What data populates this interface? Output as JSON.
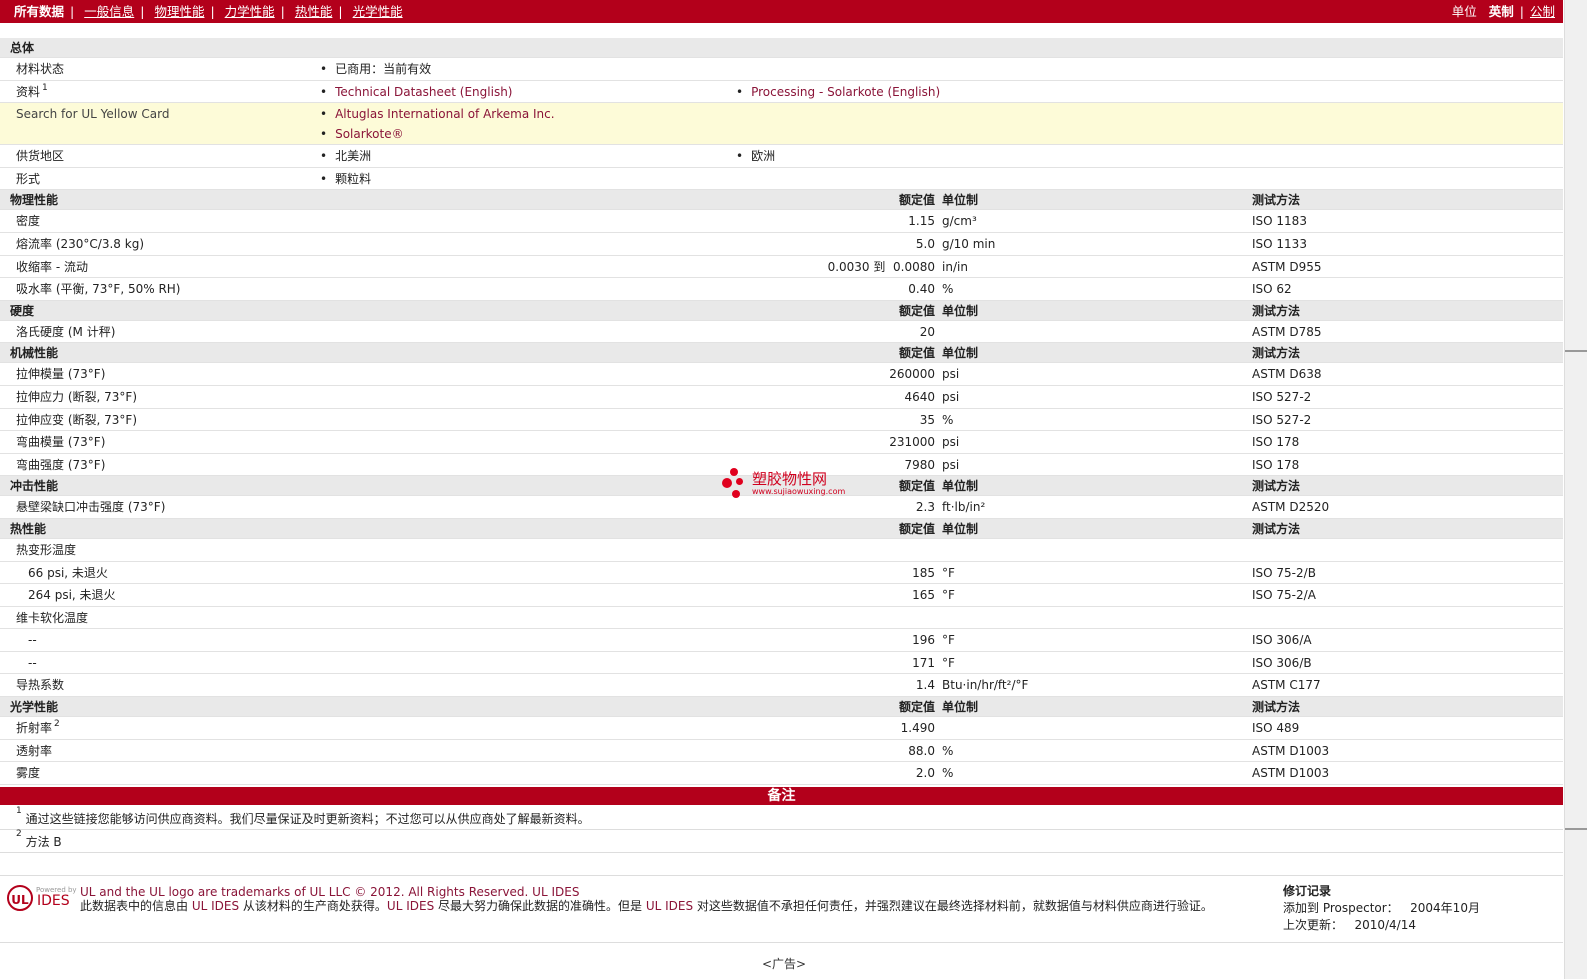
{
  "nav": {
    "items": [
      "所有数据",
      "一般信息",
      "物理性能",
      "力学性能",
      "热性能",
      "光学性能"
    ],
    "unit_label": "单位",
    "unit_imperial": "英制",
    "unit_metric": "公制"
  },
  "general": {
    "title": "总体",
    "material_status_label": "材料状态",
    "material_status_value": "已商用：当前有效",
    "docs_label": "资料",
    "docs_sup": "1",
    "doc1": "Technical Datasheet (English)",
    "doc2": "Processing - Solarkote (English)",
    "ul_label": "Search for UL Yellow Card",
    "ul1": "Altuglas International of Arkema Inc.",
    "ul2": "Solarkote®",
    "region_label": "供货地区",
    "region1": "北美洲",
    "region2": "欧洲",
    "form_label": "形式",
    "form_value": "颗粒料"
  },
  "col_headers": {
    "value": "额定值",
    "unit": "单位制",
    "test": "测试方法"
  },
  "physical": {
    "title": "物理性能",
    "rows": [
      {
        "label": "密度",
        "cond": "",
        "value": "1.15",
        "unit": "g/cm³",
        "test": "ISO 1183"
      },
      {
        "label": "熔流率",
        "cond": "(230°C/3.8 kg)",
        "value": "5.0",
        "unit": "g/10 min",
        "test": "ISO 1133"
      },
      {
        "label": "收缩率",
        "cond": "- 流动",
        "value": "0.0030 到  0.0080",
        "unit": "in/in",
        "test": "ASTM D955"
      },
      {
        "label": "吸水率",
        "cond": "(平衡, 73°F, 50% RH)",
        "value": "0.40",
        "unit": "%",
        "test": "ISO 62"
      }
    ]
  },
  "hardness": {
    "title": "硬度",
    "rows": [
      {
        "label": "洛氏硬度",
        "cond": "(M 计秤)",
        "value": "20",
        "unit": "",
        "test": "ASTM D785"
      }
    ]
  },
  "mechanical": {
    "title": "机械性能",
    "rows": [
      {
        "label": "拉伸模量",
        "cond": "(73°F)",
        "value": "260000",
        "unit": "psi",
        "test": "ASTM D638"
      },
      {
        "label": "拉伸应力",
        "cond": "(断裂, 73°F)",
        "value": "4640",
        "unit": "psi",
        "test": "ISO 527-2"
      },
      {
        "label": "拉伸应变",
        "cond": "(断裂, 73°F)",
        "value": "35",
        "unit": "%",
        "test": "ISO 527-2"
      },
      {
        "label": "弯曲模量",
        "cond": "(73°F)",
        "value": "231000",
        "unit": "psi",
        "test": "ISO 178"
      },
      {
        "label": "弯曲强度",
        "cond": "(73°F)",
        "value": "7980",
        "unit": "psi",
        "test": "ISO 178"
      }
    ]
  },
  "impact": {
    "title": "冲击性能",
    "rows": [
      {
        "label": "悬壁梁缺口冲击强度",
        "cond": "(73°F)",
        "value": "2.3",
        "unit": "ft·lb/in²",
        "test": "ASTM D2520"
      }
    ]
  },
  "thermal": {
    "title": "热性能",
    "hdt_label": "热变形温度",
    "hdt_rows": [
      {
        "label": "66 psi, 未退火",
        "value": "185",
        "unit": "°F",
        "test": "ISO 75-2/B"
      },
      {
        "label": "264 psi, 未退火",
        "value": "165",
        "unit": "°F",
        "test": "ISO 75-2/A"
      }
    ],
    "vicat_label": "维卡软化温度",
    "vicat_rows": [
      {
        "label": "--",
        "value": "196",
        "unit": "°F",
        "test": "ISO 306/A"
      },
      {
        "label": "--",
        "value": "171",
        "unit": "°F",
        "test": "ISO 306/B"
      }
    ],
    "conductivity": {
      "label": "导热系数",
      "value": "1.4",
      "unit": "Btu·in/hr/ft²/°F",
      "test": "ASTM C177"
    }
  },
  "optical": {
    "title": "光学性能",
    "rows": [
      {
        "label": "折射率",
        "sup": "2",
        "value": "1.490",
        "unit": "",
        "test": "ISO 489"
      },
      {
        "label": "透射率",
        "sup": "",
        "value": "88.0",
        "unit": "%",
        "test": "ASTM D1003"
      },
      {
        "label": "雾度",
        "sup": "",
        "value": "2.0",
        "unit": "%",
        "test": "ASTM D1003"
      }
    ]
  },
  "notes": {
    "title": "备注",
    "n1_sup": "1",
    "n1": "通过这些链接您能够访问供应商资料。我们尽量保证及时更新资料；不过您可以从供应商处了解最新资料。",
    "n2_sup": "2",
    "n2": "方法 B"
  },
  "watermark": {
    "main": "塑胶物性网",
    "sub": "www.sujiaowuxing.com"
  },
  "footer": {
    "ul_logo": "UL",
    "powered": "Powered by",
    "ides": "IDES",
    "line1": "UL and the UL logo are trademarks of UL LLC © 2012. All Rights Reserved. UL IDES",
    "line2a": "此数据表中的信息由 ",
    "line2b": "UL IDES",
    "line2c": " 从该材料的生产商处获得。",
    "line2d": "UL IDES",
    "line2e": " 尽最大努力确保此数据的准确性。但是 ",
    "line2f": "UL IDES",
    "line2g": " 对这些数据值不承担任何责任，并强烈建议在最终选择材料前，就数据值与材料供应商进行验证。",
    "rev_title": "修订记录",
    "added_label": "添加到 Prospector：",
    "added_value": "2004年10月",
    "updated_label": "上次更新：",
    "updated_value": "2010/4/14",
    "ad": "<广告>"
  }
}
